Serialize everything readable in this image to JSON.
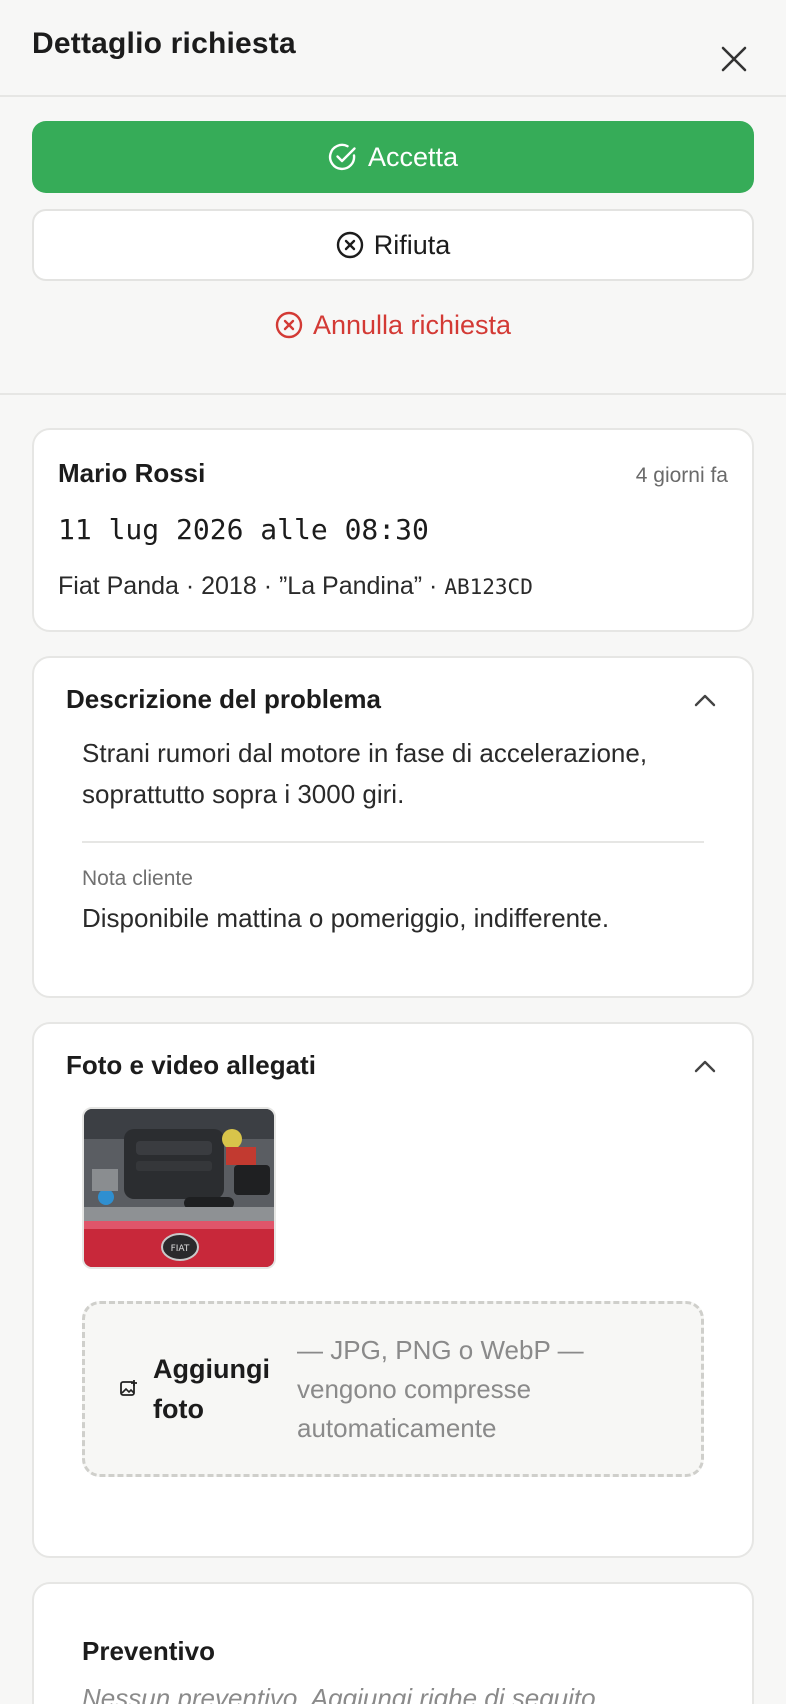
{
  "header": {
    "title": "Dettaglio richiesta"
  },
  "actions": {
    "accept_label": "Accetta",
    "reject_label": "Rifiuta",
    "cancel_label": "Annulla richiesta"
  },
  "summary": {
    "customer_name": "Mario Rossi",
    "time_ago": "4 giorni fa",
    "appointment": "11 lug 2026 alle 08:30",
    "vehicle": "Fiat Panda · 2018 · ”La Pandina” ·",
    "plate": "AB123CD"
  },
  "description": {
    "title": "Descrizione del problema",
    "text": "Strani rumori dal motore in fase di accelerazione, soprattutto sopra i 3000 giri.",
    "note_label": "Nota cliente",
    "note_text": "Disponibile mattina o pomeriggio, indifferente."
  },
  "media": {
    "title": "Foto e video allegati",
    "upload_label": "Aggiungi foto",
    "upload_hint": "— JPG, PNG o WebP — vengono compresse automaticamente"
  },
  "quote": {
    "title": "Preventivo",
    "subtitle": "Nessun preventivo. Aggiungi righe di seguito."
  },
  "colors": {
    "accept": "#36ac58",
    "cancel": "#d33a35",
    "background": "#f7f7f6"
  }
}
